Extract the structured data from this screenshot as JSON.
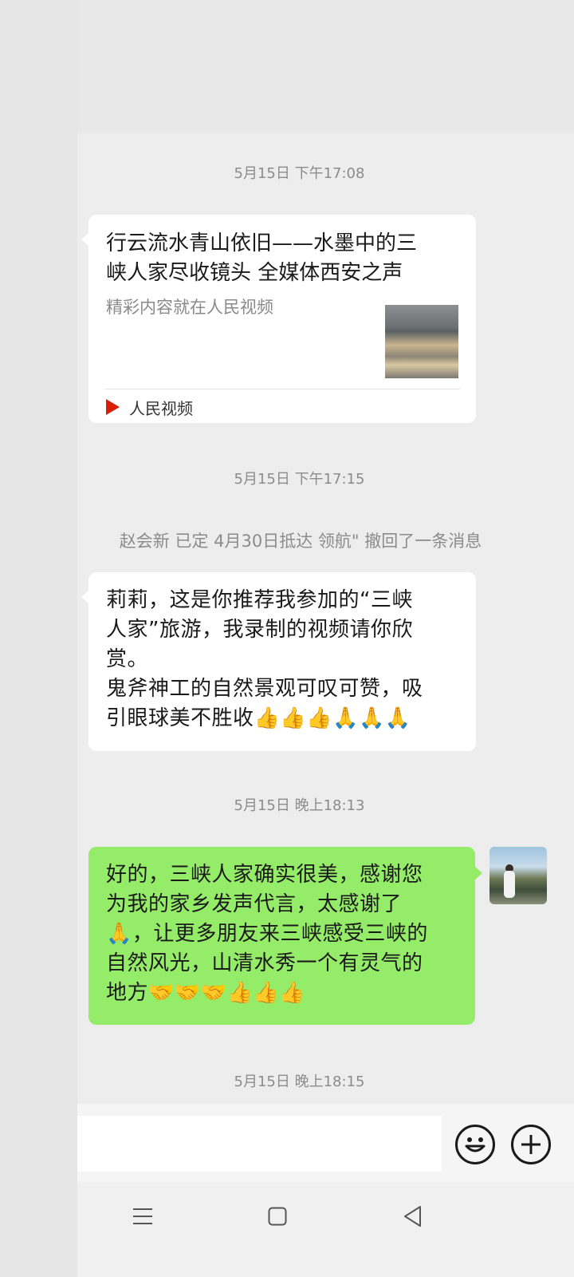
{
  "timestamps": [
    "5月15日 下午17:08",
    "5月15日 下午17:15",
    "5月15日 晚上18:13",
    "5月15日 晚上18:15"
  ],
  "shared_card": {
    "title_lines": [
      "行云流水青山依旧——水墨中的三",
      "峡人家尽收镜头 全媒体西安之声"
    ],
    "description": "精彩内容就在人民视频",
    "source": "人民视频",
    "source_icon": "play-icon"
  },
  "system_message": "赵会新 已定 4月30日抵达 领航\" 撤回了一条消息",
  "incoming_message": {
    "lines": [
      "莉莉，这是你推荐我参加的“三峡",
      "人家”旅游，我录制的视频请你欣",
      "赏。",
      "鬼斧神工的自然景观可叹可赞，吸",
      "引眼球美不胜收👍👍👍🙏🙏🙏"
    ]
  },
  "outgoing_message": {
    "lines": [
      "好的，三峡人家确实很美，感谢您",
      "为我的家乡发声代言，太感谢了",
      "🙏，让更多朋友来三峡感受三峡的",
      "自然风光，山清水秀一个有灵气的",
      "地方🤝🤝🤝👍👍👍"
    ]
  },
  "input": {
    "placeholder": ""
  },
  "icons": {
    "emoji": "smiley-icon",
    "more": "plus-icon",
    "nav_menu": "menu-icon",
    "nav_home": "home-square-icon",
    "nav_back": "back-triangle-icon"
  },
  "colors": {
    "chat_bg": "#ededed",
    "bubble_in": "#ffffff",
    "bubble_out": "#95ec69",
    "meta_text": "#8c8c8c",
    "source_icon": "#d81e06"
  }
}
